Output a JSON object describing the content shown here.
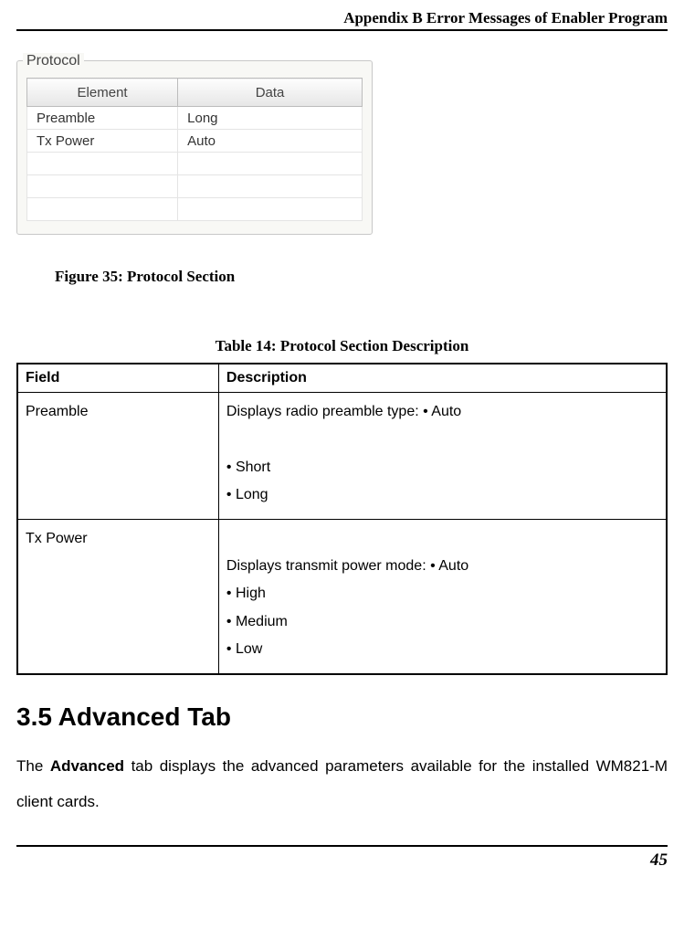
{
  "header": {
    "title": "Appendix B Error Messages of Enabler Program"
  },
  "figure": {
    "legend": "Protocol",
    "columns": {
      "c1": "Element",
      "c2": "Data"
    },
    "rows": [
      {
        "element": "Preamble",
        "data": "Long"
      },
      {
        "element": "Tx Power",
        "data": "Auto"
      }
    ],
    "caption_prefix": "Figure 35:",
    "caption_title": " Protocol Section"
  },
  "table_caption": {
    "prefix": "Table 14:",
    "title": " Protocol Section Description"
  },
  "desc_table": {
    "headers": {
      "field": "Field",
      "description": "Description"
    },
    "rows": [
      {
        "field": "Preamble",
        "desc_line1": "Displays radio preamble type: • Auto",
        "desc_line2": "• Short",
        "desc_line3": "• Long"
      },
      {
        "field": "Tx Power",
        "desc_line1": "Displays transmit power mode: • Auto",
        "desc_line2": "• High",
        "desc_line3": "• Medium",
        "desc_line4": "• Low"
      }
    ]
  },
  "section": {
    "heading": "3.5 Advanced Tab",
    "para_before_bold": "The ",
    "para_bold": "Advanced",
    "para_after_bold": " tab displays the advanced parameters available for the installed WM821-M client cards."
  },
  "footer": {
    "page_number": "45"
  }
}
